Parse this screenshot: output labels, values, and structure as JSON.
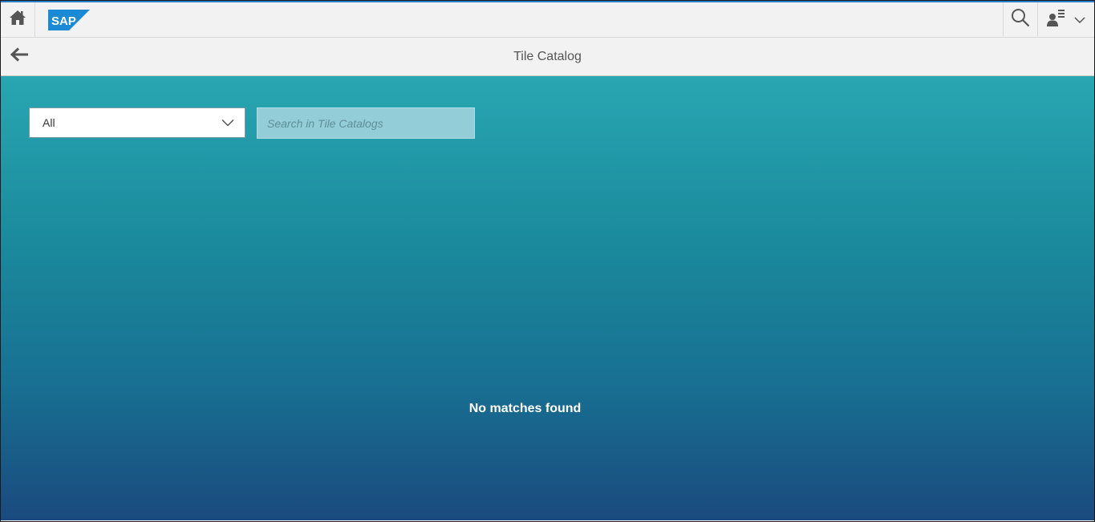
{
  "shell": {
    "home_icon": "home-icon",
    "logo_text": "SAP",
    "search_icon": "search-icon",
    "user_icon": "user-menu-icon",
    "dropdown_icon": "chevron-down-icon",
    "accent_color": "#2a7dc8"
  },
  "header": {
    "back_icon": "arrow-left-icon",
    "title": "Tile Catalog"
  },
  "filters": {
    "catalog_select_value": "All",
    "search_placeholder": "Search in Tile Catalogs"
  },
  "content": {
    "empty_message": "No matches found",
    "gradient_top": "#29a6b2",
    "gradient_bottom": "#1a4a7e"
  }
}
